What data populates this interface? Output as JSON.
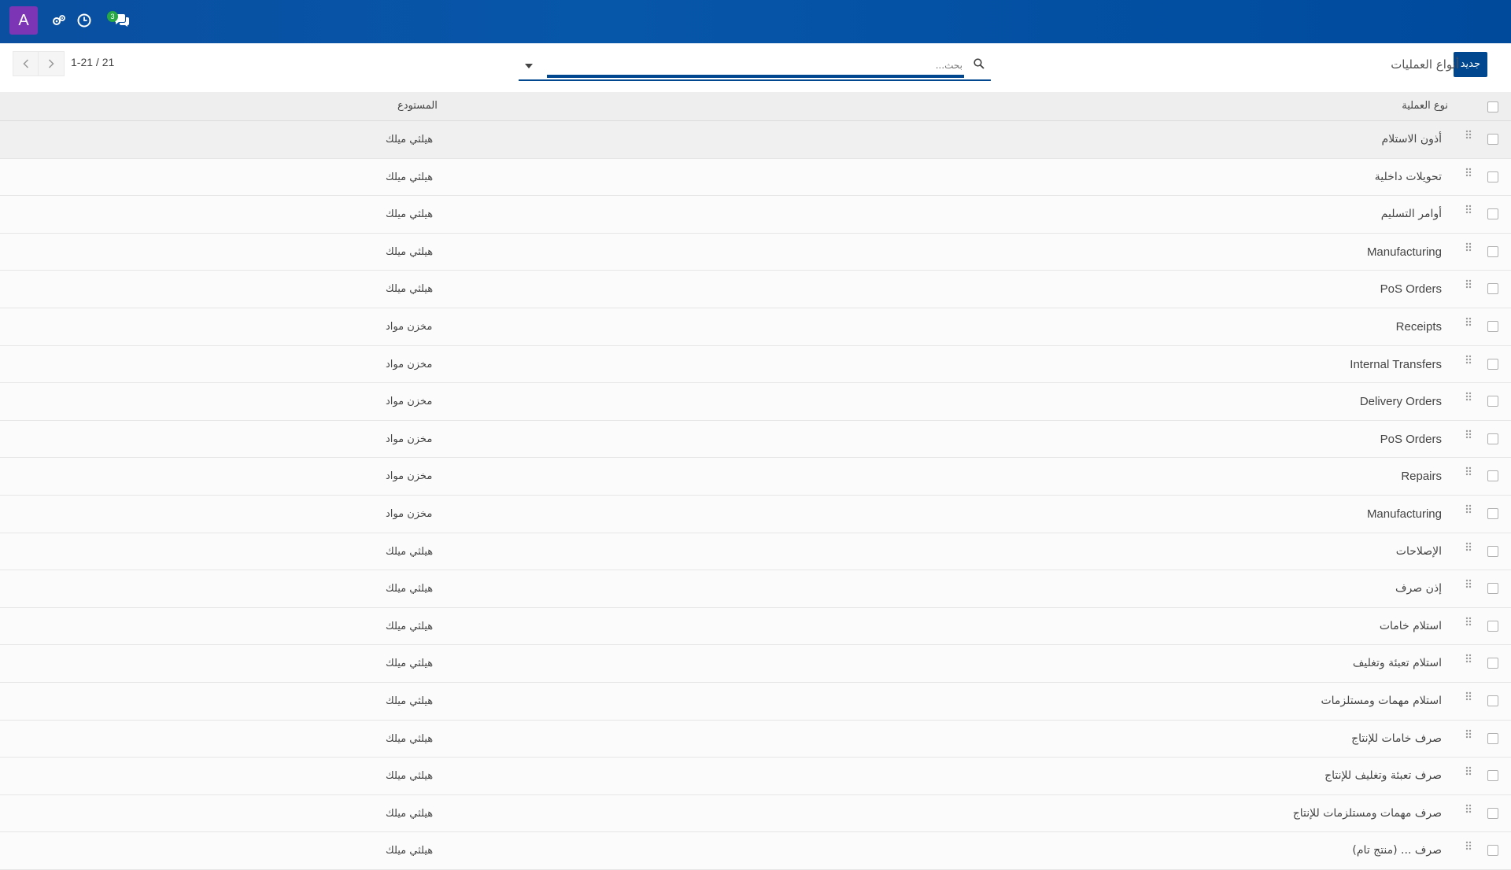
{
  "navbar": {
    "avatar_letter": "A",
    "messages_badge": "3",
    "icons": [
      "settings-icon",
      "clock-icon",
      "chat-icon"
    ]
  },
  "control": {
    "new_button": "جديد",
    "breadcrumb": "أنواع العمليات",
    "search_placeholder": "بحث...",
    "pager": "1-21 / 21"
  },
  "table": {
    "headers": {
      "select_all": "",
      "operation_type": "نوع العملية",
      "warehouse": "المستودع"
    },
    "rows": [
      {
        "type": "أذون الاستلام",
        "warehouse": "هيلثي ميلك"
      },
      {
        "type": "تحويلات داخلية",
        "warehouse": "هيلثي ميلك"
      },
      {
        "type": "أوامر التسليم",
        "warehouse": "هيلثي ميلك"
      },
      {
        "type": "Manufacturing",
        "warehouse": "هيلثي ميلك"
      },
      {
        "type": "PoS Orders",
        "warehouse": "هيلثي ميلك"
      },
      {
        "type": "Receipts",
        "warehouse": "مخزن مواد"
      },
      {
        "type": "Internal Transfers",
        "warehouse": "مخزن مواد"
      },
      {
        "type": "Delivery Orders",
        "warehouse": "مخزن مواد"
      },
      {
        "type": "PoS Orders",
        "warehouse": "مخزن مواد"
      },
      {
        "type": "Repairs",
        "warehouse": "مخزن مواد"
      },
      {
        "type": "Manufacturing",
        "warehouse": "مخزن مواد"
      },
      {
        "type": "الإصلاحات",
        "warehouse": "هيلثي ميلك"
      },
      {
        "type": "إذن صرف",
        "warehouse": "هيلثي ميلك"
      },
      {
        "type": "استلام خامات",
        "warehouse": "هيلثي ميلك"
      },
      {
        "type": "استلام تعبئة وتغليف",
        "warehouse": "هيلثي ميلك"
      },
      {
        "type": "استلام مهمات ومستلزمات",
        "warehouse": "هيلثي ميلك"
      },
      {
        "type": "صرف خامات للإنتاج",
        "warehouse": "هيلثي ميلك"
      },
      {
        "type": "صرف تعبئة وتغليف للإنتاج",
        "warehouse": "هيلثي ميلك"
      },
      {
        "type": "صرف مهمات ومستلزمات للإنتاج",
        "warehouse": "هيلثي ميلك"
      },
      {
        "type": "صرف ... (منتج تام)",
        "warehouse": "هيلثي ميلك"
      }
    ]
  },
  "colors": {
    "navbar": "#0656aa",
    "primary_button": "#00478f",
    "avatar": "#7b35b5",
    "badge": "#28a745"
  }
}
